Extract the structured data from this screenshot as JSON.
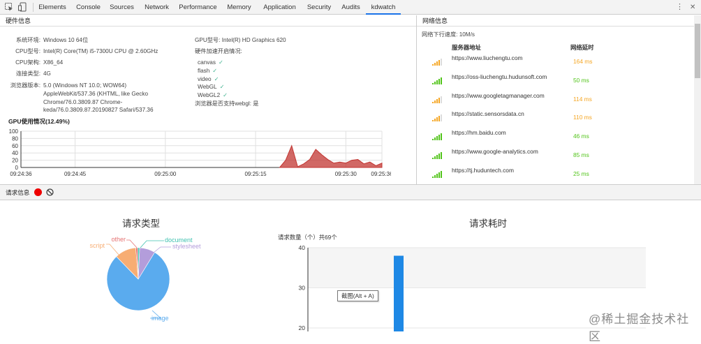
{
  "devtools": {
    "tabs": [
      "Elements",
      "Console",
      "Sources",
      "Network",
      "Performance",
      "Memory",
      "Application",
      "Security",
      "Audits",
      "kdwatch"
    ],
    "active_tab": "kdwatch",
    "more": "⋮",
    "close": "✕"
  },
  "hardware": {
    "title": "硬件信息",
    "fields": [
      {
        "label": "系统环境:",
        "value": "Windows 10 64位"
      },
      {
        "label": "CPU型号:",
        "value": "Intel(R) Core(TM) i5-7300U CPU @ 2.60GHz"
      },
      {
        "label": "CPU架构:",
        "value": "X86_64"
      },
      {
        "label": "连接类型:",
        "value": "4G"
      },
      {
        "label": "浏览器版本:",
        "value": "5.0 (Windows NT 10.0; WOW64)"
      }
    ],
    "browser_lines": [
      "AppleWebKit/537.36 (KHTML, like Gecko",
      "Chrome/76.0.3809.87 Chrome-",
      "keda/76.0.3809.87.20190827 Safari/537.36"
    ],
    "gpu_label": "GPU型号:",
    "gpu_value": "Intel(R) HD Graphics 620",
    "accel_label": "硬件加速开启情况:",
    "accel_items": [
      "canvas",
      "flash",
      "video",
      "WebGL",
      "WebGL2"
    ],
    "check": "✓",
    "webgl_label": "浏览器是否支持webgl:",
    "webgl_value": "是"
  },
  "gpu_chart": {
    "title": "GPU使用情况(12.49%)",
    "chart_data": {
      "type": "area",
      "ylim": [
        0,
        100
      ],
      "yticks": [
        0,
        20,
        40,
        60,
        80,
        100
      ],
      "xticks": [
        "09:24:36",
        "09:24:45",
        "09:25:00",
        "09:25:15",
        "09:25:30",
        "09:25:36"
      ],
      "x": [
        "09:25:19",
        "09:25:20",
        "09:25:21",
        "09:25:22",
        "09:25:23",
        "09:25:24",
        "09:25:25",
        "09:25:26",
        "09:25:27",
        "09:25:28",
        "09:25:29",
        "09:25:30",
        "09:25:31",
        "09:25:32",
        "09:25:33",
        "09:25:34",
        "09:25:35",
        "09:25:36"
      ],
      "values": [
        0,
        20,
        60,
        2,
        10,
        22,
        50,
        35,
        22,
        12,
        15,
        12,
        20,
        22,
        10,
        15,
        5,
        12
      ],
      "color": "#c23531"
    }
  },
  "network": {
    "title": "网络信息",
    "speed_label": "网络下行速度:",
    "speed_value": "10M/s",
    "col_host": "服务器地址",
    "col_latency": "网络延时",
    "rows": [
      {
        "host": "https://www.liuchengtu.com",
        "latency": "164 ms",
        "color": "#f5a623",
        "bars": 3
      },
      {
        "host": "https://oss-liuchengtu.hudunsoft.com",
        "latency": "50 ms",
        "color": "#52c41a",
        "bars": 5
      },
      {
        "host": "https://www.googletagmanager.com",
        "latency": "114 ms",
        "color": "#f5a623",
        "bars": 3
      },
      {
        "host": "https://static.sensorsdata.cn",
        "latency": "110 ms",
        "color": "#f5a623",
        "bars": 3
      },
      {
        "host": "https://hm.baidu.com",
        "latency": "46 ms",
        "color": "#52c41a",
        "bars": 5
      },
      {
        "host": "https://www.google-analytics.com",
        "latency": "85 ms",
        "color": "#52c41a",
        "bars": 5
      },
      {
        "host": "https://tj.huduntech.com",
        "latency": "25 ms",
        "color": "#52c41a",
        "bars": 5
      }
    ]
  },
  "request": {
    "label": "请求信息",
    "record_color": "#e00",
    "pie": {
      "title": "请求类型",
      "chart_data": {
        "type": "pie",
        "categories": [
          "image",
          "script",
          "other",
          "document",
          "stylesheet"
        ],
        "values": [
          79,
          11,
          1,
          1,
          8
        ],
        "colors": [
          "#5aabee",
          "#f7ad73",
          "#e57373",
          "#3fc1b0",
          "#b39ddb"
        ]
      }
    },
    "bar": {
      "title": "请求耗时",
      "summary": "请求数量（个）共69个",
      "tooltip": "截图(Alt + A)",
      "chart_data": {
        "type": "bar",
        "yticks": [
          20,
          30,
          40
        ],
        "values": [
          38
        ],
        "color": "#1e88e5"
      }
    }
  },
  "watermark": "@稀土掘金技术社区"
}
